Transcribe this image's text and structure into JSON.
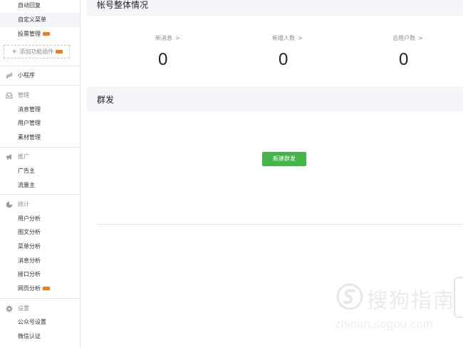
{
  "sidebar": {
    "top_items": [
      {
        "label": "自动回复"
      },
      {
        "label": "自定义菜单"
      },
      {
        "label": "投票管理",
        "badge": "new"
      }
    ],
    "add_plugin_label": "添加功能插件",
    "mini_program": {
      "label": "小程序"
    },
    "management": {
      "label": "管理",
      "items": [
        "消息管理",
        "用户管理",
        "素材管理"
      ]
    },
    "promotion": {
      "label": "推广",
      "items": [
        "广告主",
        "流量主"
      ]
    },
    "statistics": {
      "label": "统计",
      "items": [
        "用户分析",
        "图文分析",
        "菜单分析",
        "消息分析",
        "接口分析",
        "网页分析"
      ]
    },
    "settings": {
      "label": "设置",
      "items": [
        "公众号设置",
        "微信认证"
      ]
    }
  },
  "overview": {
    "title": "帐号整体情况",
    "stats": [
      {
        "label": "新消息",
        "value": "0"
      },
      {
        "label": "新增人数",
        "value": "0"
      },
      {
        "label": "总用户数",
        "value": "0"
      }
    ]
  },
  "mass_send": {
    "title": "群发",
    "new_button_label": "新建群发"
  },
  "watermark": {
    "text": "搜狗指南",
    "url": "zhinan.sogou.com"
  },
  "colors": {
    "accent_green": "#44b549",
    "new_badge": "#f37b1d",
    "panel_bg": "#f4f5f9"
  }
}
